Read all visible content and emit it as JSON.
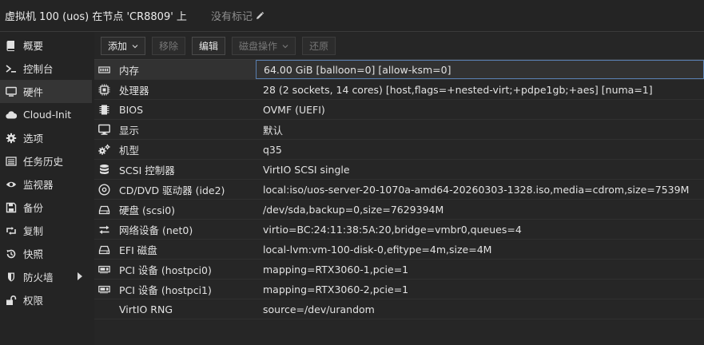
{
  "header": {
    "title": "虚拟机 100 (uos) 在节点 'CR8809' 上",
    "tags": "没有标记"
  },
  "sidebar": {
    "items": [
      {
        "label": "概要",
        "icon": "book-icon"
      },
      {
        "label": "控制台",
        "icon": "terminal-icon"
      },
      {
        "label": "硬件",
        "icon": "monitor-icon"
      },
      {
        "label": "Cloud-Init",
        "icon": "cloud-icon"
      },
      {
        "label": "选项",
        "icon": "gear-icon"
      },
      {
        "label": "任务历史",
        "icon": "list-icon"
      },
      {
        "label": "监视器",
        "icon": "eye-icon"
      },
      {
        "label": "备份",
        "icon": "floppy-icon"
      },
      {
        "label": "复制",
        "icon": "retweet-icon"
      },
      {
        "label": "快照",
        "icon": "history-icon"
      },
      {
        "label": "防火墙",
        "icon": "shield-icon"
      },
      {
        "label": "权限",
        "icon": "unlock-icon"
      }
    ],
    "active": "硬件"
  },
  "toolbar": {
    "add": "添加",
    "remove": "移除",
    "edit": "编辑",
    "disk_action": "磁盘操作",
    "revert": "还原"
  },
  "hardware": [
    {
      "key": "内存",
      "value": "64.00 GiB [balloon=0] [allow-ksm=0]",
      "icon": "memory-icon"
    },
    {
      "key": "处理器",
      "value": "28 (2 sockets, 14 cores) [host,flags=+nested-virt;+pdpe1gb;+aes] [numa=1]",
      "icon": "cpu-icon"
    },
    {
      "key": "BIOS",
      "value": "OVMF (UEFI)",
      "icon": "chip-icon"
    },
    {
      "key": "显示",
      "value": "默认",
      "icon": "desktop-icon"
    },
    {
      "key": "机型",
      "value": "q35",
      "icon": "cogs-icon"
    },
    {
      "key": "SCSI 控制器",
      "value": "VirtIO SCSI single",
      "icon": "database-icon"
    },
    {
      "key": "CD/DVD 驱动器 (ide2)",
      "value": "local:iso/uos-server-20-1070a-amd64-20260303-1328.iso,media=cdrom,size=7539M",
      "icon": "cdrom-icon"
    },
    {
      "key": "硬盘 (scsi0)",
      "value": "/dev/sda,backup=0,size=7629394M",
      "icon": "harddisk-icon"
    },
    {
      "key": "网络设备 (net0)",
      "value": "virtio=BC:24:11:38:5A:20,bridge=vmbr0,queues=4",
      "icon": "exchange-icon"
    },
    {
      "key": "EFI 磁盘",
      "value": "local-lvm:vm-100-disk-0,efitype=4m,size=4M",
      "icon": "harddisk-icon"
    },
    {
      "key": "PCI 设备 (hostpci0)",
      "value": "mapping=RTX3060-1,pcie=1",
      "icon": "pci-card-icon"
    },
    {
      "key": "PCI 设备 (hostpci1)",
      "value": "mapping=RTX3060-2,pcie=1",
      "icon": "pci-card-icon"
    },
    {
      "key": "VirtIO RNG",
      "value": "source=/dev/urandom",
      "icon": ""
    }
  ],
  "selected_row": "内存"
}
